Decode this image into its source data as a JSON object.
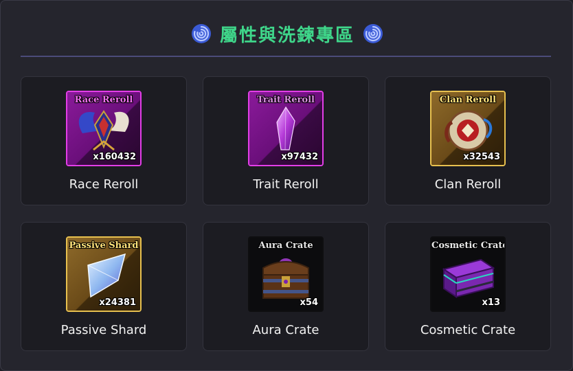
{
  "header": {
    "title": "屬性與洗鍊專區",
    "left_icon": "swirl-icon",
    "right_icon": "swirl-icon",
    "title_color": "#3fd68a"
  },
  "items": [
    {
      "icon_text": "Race Reroll",
      "quantity": "x160432",
      "label": "Race Reroll",
      "rarity_color": "#e33ee8",
      "name_color": "#f06ef0",
      "icon": "winged-emblem-icon"
    },
    {
      "icon_text": "Trait Reroll",
      "quantity": "x97432",
      "label": "Trait Reroll",
      "rarity_color": "#e33ee8",
      "name_color": "#d98ee0",
      "icon": "purple-crystal-icon"
    },
    {
      "icon_text": "Clan Reroll",
      "quantity": "x32543",
      "label": "Clan Reroll",
      "rarity_color": "#e8c14f",
      "name_color": "#ffe27a",
      "icon": "clan-scroll-icon"
    },
    {
      "icon_text": "Passive Shard",
      "quantity": "x24381",
      "label": "Passive Shard",
      "rarity_color": "#e8c14f",
      "name_color": "#ffe27a",
      "icon": "blue-shard-icon"
    },
    {
      "icon_text": "Aura Crate",
      "quantity": "x54",
      "label": "Aura Crate",
      "rarity_color": "#0e0e10",
      "name_color": "#e6e6e6",
      "icon": "treasure-chest-icon"
    },
    {
      "icon_text": "Cosmetic Crate",
      "quantity": "x13",
      "label": "Cosmetic Crate",
      "rarity_color": "#0e0e10",
      "name_color": "#e6e6e6",
      "icon": "cosmetic-crate-icon"
    }
  ]
}
